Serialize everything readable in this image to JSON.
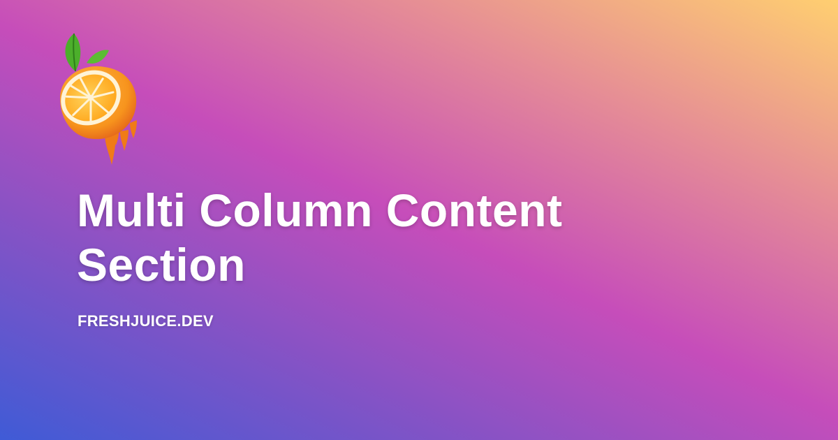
{
  "logo": {
    "icon": "orange-slice-logo",
    "colors": {
      "peel": "#f7941d",
      "pulp": "#ffb21a",
      "leaf": "#4caf2b"
    }
  },
  "hero": {
    "title": "Multi Column Content Section",
    "site": "FRESHJUICE.DEV"
  },
  "background": {
    "gradient": [
      "#3f5bd6",
      "#8153c6",
      "#c64dba",
      "#e58c96",
      "#ffcf70"
    ]
  }
}
